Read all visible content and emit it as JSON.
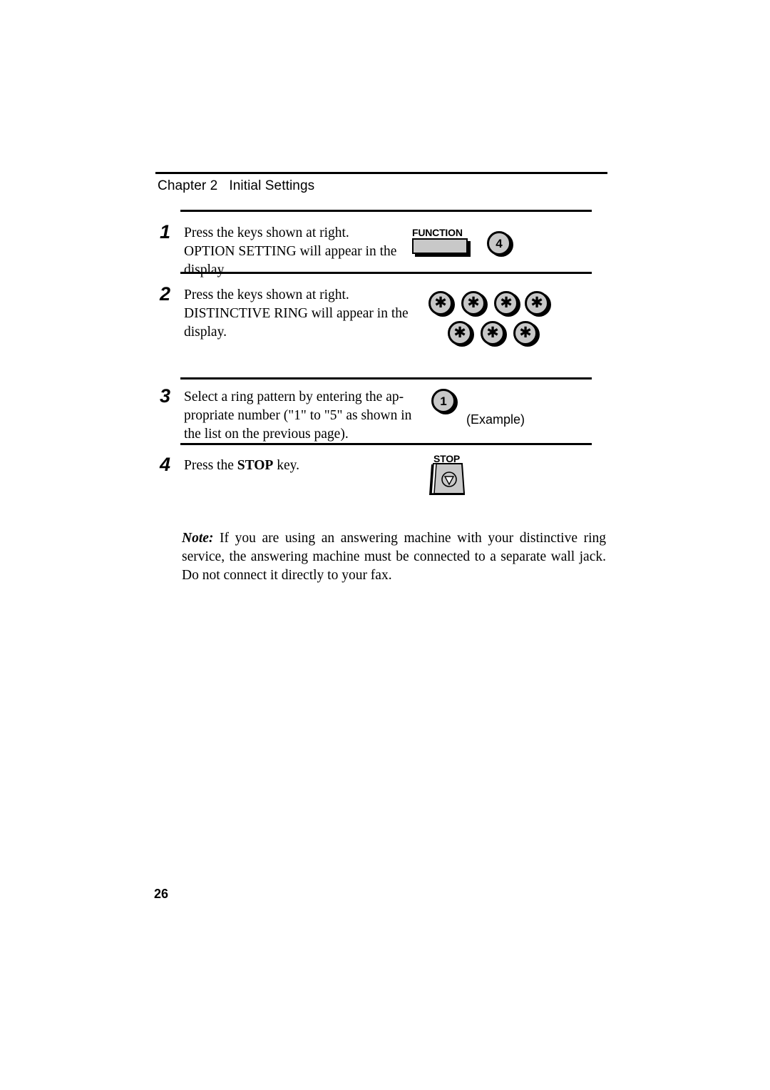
{
  "header": {
    "chapter_label": "Chapter 2",
    "chapter_title": "Initial Settings"
  },
  "steps": [
    {
      "number": "1",
      "text_lines": [
        "Press the keys shown at right.",
        "OPTION SETTING will appear in the",
        "display."
      ],
      "keys": {
        "function_label": "FUNCTION",
        "numeric_key": "4"
      }
    },
    {
      "number": "2",
      "text_lines": [
        "Press the keys shown at right.",
        "DISTINCTIVE RING will appear in the",
        "display."
      ],
      "keys": {
        "star_row_one": [
          "✱",
          "✱",
          "✱",
          "✱"
        ],
        "star_row_two": [
          "✱",
          "✱",
          "✱"
        ]
      }
    },
    {
      "number": "3",
      "text_lines": [
        "Select a ring pattern by entering the ap-",
        "propriate number (\"1\" to \"5\" as shown in",
        "the list on the previous page)."
      ],
      "keys": {
        "numeric_key": "1",
        "example_caption": "(Example)"
      }
    },
    {
      "number": "4",
      "text_prefix": "Press the ",
      "text_bold": "STOP",
      "text_suffix": " key.",
      "keys": {
        "stop_label": "STOP"
      }
    }
  ],
  "note": {
    "keyword": "Note:",
    "body": " If you are using an answering machine with your distinctive ring service, the answering machine must be connected to a separate wall jack. Do not connect it directly to your fax."
  },
  "folio": {
    "page_number": "26"
  },
  "colors": {
    "key_fill": "#c8c8c8",
    "ink": "#000000",
    "paper": "#ffffff"
  }
}
